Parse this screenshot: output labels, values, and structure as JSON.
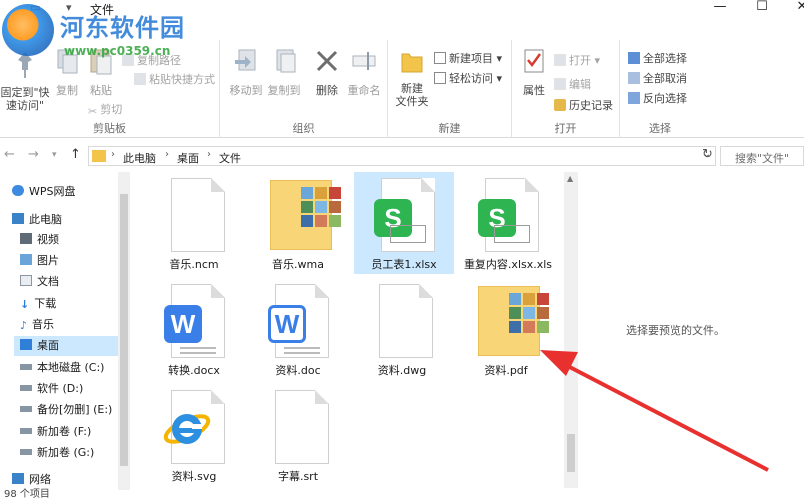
{
  "window": {
    "title": "文件",
    "minimize": "—",
    "maximize": "☐",
    "close": "✕"
  },
  "watermark": {
    "name": "河东软件园",
    "url": "www.pc0359.cn"
  },
  "ribbon": {
    "clipboard": {
      "label": "剪贴板",
      "pin": "固定到\"快\n速访问\"",
      "copy": "复制",
      "paste": "粘贴",
      "copy_path": "复制路径",
      "paste_shortcut": "粘贴快捷方式",
      "cut": "剪切"
    },
    "organize": {
      "label": "组织",
      "move_to": "移动到",
      "copy_to": "复制到",
      "delete": "删除",
      "rename": "重命名"
    },
    "new": {
      "label": "新建",
      "new_folder": "新建\n文件夹",
      "new_item": "新建项目",
      "easy_access": "轻松访问"
    },
    "open": {
      "label": "打开",
      "properties": "属性",
      "open": "打开",
      "edit": "编辑",
      "history": "历史记录"
    },
    "select": {
      "label": "选择",
      "select_all": "全部选择",
      "select_none": "全部取消",
      "invert": "反向选择"
    }
  },
  "address": {
    "crumbs": [
      "此电脑",
      "桌面",
      "文件"
    ],
    "search_placeholder": "搜索\"文件\""
  },
  "nav": {
    "items": [
      {
        "label": "WPS网盘",
        "icon": "cloud-icon"
      },
      {
        "label": "此电脑",
        "icon": "computer-icon"
      },
      {
        "label": "视频",
        "icon": "video-icon"
      },
      {
        "label": "图片",
        "icon": "picture-icon"
      },
      {
        "label": "文档",
        "icon": "document-icon"
      },
      {
        "label": "下载",
        "icon": "download-icon"
      },
      {
        "label": "音乐",
        "icon": "music-icon"
      },
      {
        "label": "桌面",
        "icon": "desktop-icon"
      },
      {
        "label": "本地磁盘 (C:)",
        "icon": "drive-icon"
      },
      {
        "label": "软件 (D:)",
        "icon": "drive-icon"
      },
      {
        "label": "备份[勿删] (E:)",
        "icon": "drive-icon"
      },
      {
        "label": "新加卷 (F:)",
        "icon": "drive-icon"
      },
      {
        "label": "新加卷 (G:)",
        "icon": "drive-icon"
      },
      {
        "label": "网络",
        "icon": "network-icon"
      }
    ],
    "selected": "桌面"
  },
  "files": [
    {
      "name": "音乐.ncm",
      "kind": "blank"
    },
    {
      "name": "音乐.wma",
      "kind": "folder-thumbs"
    },
    {
      "name": "员工表1.xlsx",
      "kind": "wps-sheet"
    },
    {
      "name": "重复内容.xlsx.xls",
      "kind": "wps-sheet"
    },
    {
      "name": "转换.docx",
      "kind": "wps-writer"
    },
    {
      "name": "资料.doc",
      "kind": "wps-writer-outline"
    },
    {
      "name": "资料.dwg",
      "kind": "blank"
    },
    {
      "name": "资料.pdf",
      "kind": "folder-thumbs"
    },
    {
      "name": "资料.svg",
      "kind": "ie"
    },
    {
      "name": "字幕.srt",
      "kind": "blank"
    }
  ],
  "selected_file": "员工表1.xlsx",
  "preview_text": "选择要预览的文件。",
  "status": {
    "count": "98 个项目"
  },
  "colors": {
    "selection": "#cce8ff",
    "wps_green": "#2fb452",
    "wps_blue": "#3a7ee8",
    "folder": "#f8d577",
    "arrow": "#e8312f"
  }
}
